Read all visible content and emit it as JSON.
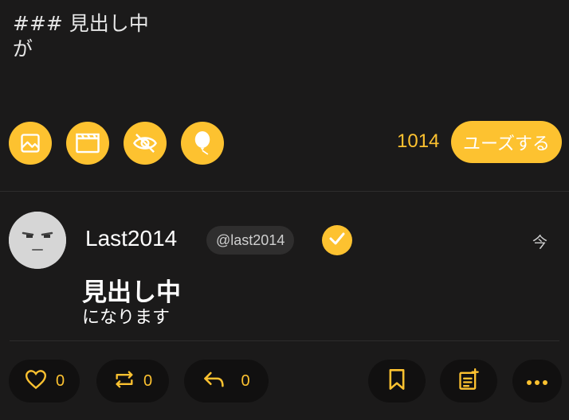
{
  "composer": {
    "text": "### 見出し中\nが",
    "char_count": "1014",
    "post_label": "ユーズする",
    "tools": [
      "image-icon",
      "clapperboard-icon",
      "eye-off-icon",
      "balloon-icon"
    ]
  },
  "note": {
    "display_name": "Last2014",
    "handle": "@last2014",
    "verified": true,
    "timestamp": "今",
    "heading": "見出し中",
    "body": "になります"
  },
  "actions": {
    "like_count": "0",
    "renote_count": "0",
    "reply_count": "0"
  },
  "colors": {
    "accent": "#fdc230",
    "background": "#1b1a1a",
    "button_background": "#111010"
  }
}
